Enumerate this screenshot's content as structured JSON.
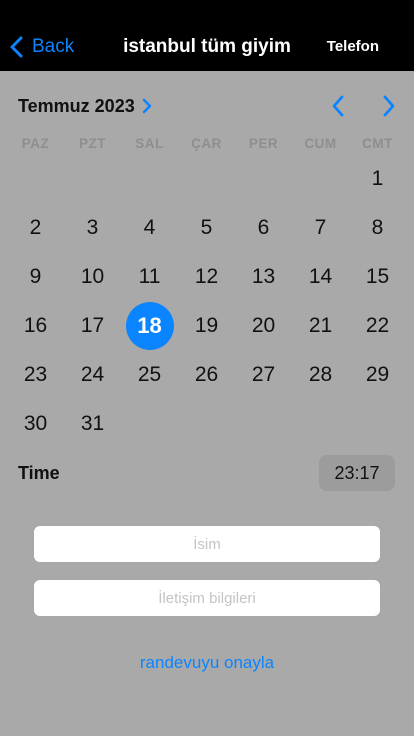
{
  "nav": {
    "back_label": "Back",
    "title": "istanbul tüm giyim",
    "right_label": "Telefon"
  },
  "calendar": {
    "month_label": "Temmuz 2023",
    "weekdays": [
      "PAZ",
      "PZT",
      "SAL",
      "ÇAR",
      "PER",
      "CUM",
      "CMT"
    ],
    "leading_blank_days": 6,
    "days": [
      "1",
      "2",
      "3",
      "4",
      "5",
      "6",
      "7",
      "8",
      "9",
      "10",
      "11",
      "12",
      "13",
      "14",
      "15",
      "16",
      "17",
      "18",
      "19",
      "20",
      "21",
      "22",
      "23",
      "24",
      "25",
      "26",
      "27",
      "28",
      "29",
      "30",
      "31"
    ],
    "selected_day": "18"
  },
  "time": {
    "label": "Time",
    "value": "23:17"
  },
  "form": {
    "name_placeholder": "İsim",
    "contact_placeholder": "İletişim bilgileri",
    "confirm_label": "randevuyu onayla"
  },
  "colors": {
    "accent": "#0a84ff",
    "background": "#a9a9a9",
    "navbar": "#000000"
  }
}
